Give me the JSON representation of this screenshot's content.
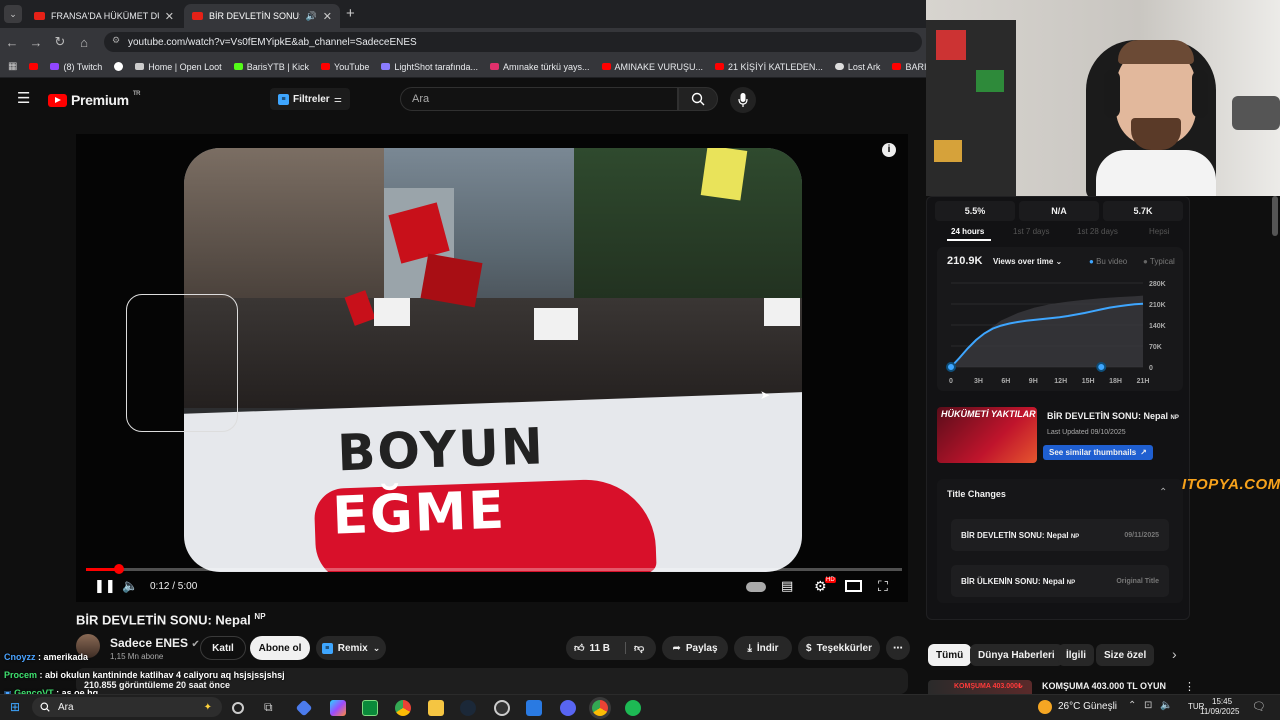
{
  "tabs": [
    {
      "label": "FRANSA'DA HÜKÜMET DÜŞTÜ"
    },
    {
      "label": "BİR DEVLETİN SONU: Nepal"
    }
  ],
  "url": "youtube.com/watch?v=Vs0fEMYipkE&ab_channel=SadeceENES",
  "bookmarks": [
    {
      "label": "(8) Twitch",
      "color": "#9146ff"
    },
    {
      "label": "Home | Open Loot",
      "color": "#ccc"
    },
    {
      "label": "BarisYTB | Kick",
      "color": "#53fc18"
    },
    {
      "label": "YouTube",
      "color": "#ff0000"
    },
    {
      "label": "LightShot tarafında...",
      "color": "#8a7cff"
    },
    {
      "label": "Amınake türkü yays...",
      "color": "#e1306c"
    },
    {
      "label": "AMINAKE VURUŞU...",
      "color": "#ff0000"
    },
    {
      "label": "21 KİŞİYİ KATLEDEN...",
      "color": "#ff0000"
    },
    {
      "label": "Lost Ark",
      "color": "#ddd"
    },
    {
      "label": "BARIŞ BRUH GİTAR...",
      "color": "#ff0000"
    }
  ],
  "header": {
    "brand": "Premium",
    "region": "TR",
    "filters": "Filtreler",
    "search_placeholder": "Ara"
  },
  "player": {
    "banner_line1": "BOYUN",
    "banner_line2": "EĞME",
    "sign_text": "BOYUN EĞME",
    "time": "0:12 / 5:00",
    "progress": 0.04,
    "hd_badge": "HD"
  },
  "video": {
    "title": "BİR DEVLETİN SONU: Nepal",
    "title_flag": "NP",
    "channel": "Sadece ENES",
    "subscribers": "1,15 Mn abone",
    "views": "210.855 görüntüleme  20 saat önce"
  },
  "actions": {
    "join": "Katıl",
    "subscribe": "Abone ol",
    "remix": "Remix",
    "likes": "11 B",
    "share": "Paylaş",
    "download": "İndir",
    "thanks": "Teşekkürler"
  },
  "chat": [
    {
      "user": "Cnoyzz",
      "msg": "amerikada",
      "color": "#4aa3ff"
    },
    {
      "user": "Procem",
      "msg": "abi okulun kantininde katlihav 4 caliyoru aq hsjsjssjshsj",
      "color": "#3fe06f"
    },
    {
      "user": "GencoVT",
      "msg": "as.oe.hg",
      "color": "#3fe06f"
    }
  ],
  "stats": {
    "ctr": "5.5%",
    "retention": "N/A",
    "likes": "5.7K"
  },
  "period_tabs": [
    "24 hours",
    "1st 7 days",
    "1st 28 days",
    "Hepsi"
  ],
  "views_chart": {
    "total": "210.9K",
    "mode": "Views over time",
    "legend_this": "Bu video",
    "legend_typical": "Typical"
  },
  "chart_data": {
    "type": "line",
    "x_labels": [
      "0",
      "3H",
      "6H",
      "9H",
      "12H",
      "15H",
      "18H",
      "21H"
    ],
    "y_ticks": [
      "280K",
      "210K",
      "140K",
      "70K",
      "0"
    ],
    "ylim": [
      0,
      280000
    ],
    "series": [
      {
        "name": "Bu video",
        "x": [
          0,
          1,
          2,
          3,
          4,
          5,
          6,
          7,
          8,
          9,
          10,
          11,
          12,
          13,
          14,
          15,
          16,
          17,
          18,
          19,
          20,
          21,
          22,
          23
        ],
        "values": [
          0,
          30000,
          62000,
          90000,
          112000,
          128000,
          138000,
          145000,
          150000,
          154000,
          157000,
          160000,
          163000,
          166000,
          170000,
          175000,
          180000,
          186000,
          192000,
          198000,
          202000,
          206000,
          209000,
          210900
        ]
      },
      {
        "name": "Typical",
        "x": [
          0,
          2,
          4,
          6,
          8,
          10,
          12,
          14,
          16,
          18,
          20,
          22,
          23
        ],
        "values": [
          0,
          60000,
          115000,
          155000,
          180000,
          198000,
          210000,
          218000,
          224000,
          229000,
          233000,
          236000,
          238000
        ]
      }
    ]
  },
  "compare": {
    "title": "BİR DEVLETİN SONU: Nepal",
    "flag": "NP",
    "updated": "Last Updated 09/10/2025",
    "similar": "See similar thumbnails",
    "thumb_text": "HÜKÜMETİ YAKTILAR"
  },
  "title_changes": {
    "heading": "Title Changes",
    "items": [
      {
        "title": "BİR DEVLETİN SONU: Nepal",
        "flag": "NP",
        "date": "09/11/2025"
      },
      {
        "title": "BİR ÜLKENİN SONU: Nepal",
        "flag": "NP",
        "date": "Original Title"
      }
    ]
  },
  "watermark": "ITOPYA.COM",
  "chips": [
    "Tümü",
    "Dünya Haberleri",
    "İlgili",
    "Size özel"
  ],
  "next_video": {
    "title": "KOMŞUMA 403.000 TL OYUN",
    "thumb_text": "KOMŞUMA 403.000₺"
  },
  "taskbar": {
    "search": "Ara",
    "weather": "26°C  Güneşli",
    "lang": "TUR",
    "time": "15:45",
    "date": "11/09/2025"
  },
  "colors": {
    "accent": "#ff0000",
    "blue": "#3ea6ff",
    "chip_active": "#f1f1f1"
  }
}
